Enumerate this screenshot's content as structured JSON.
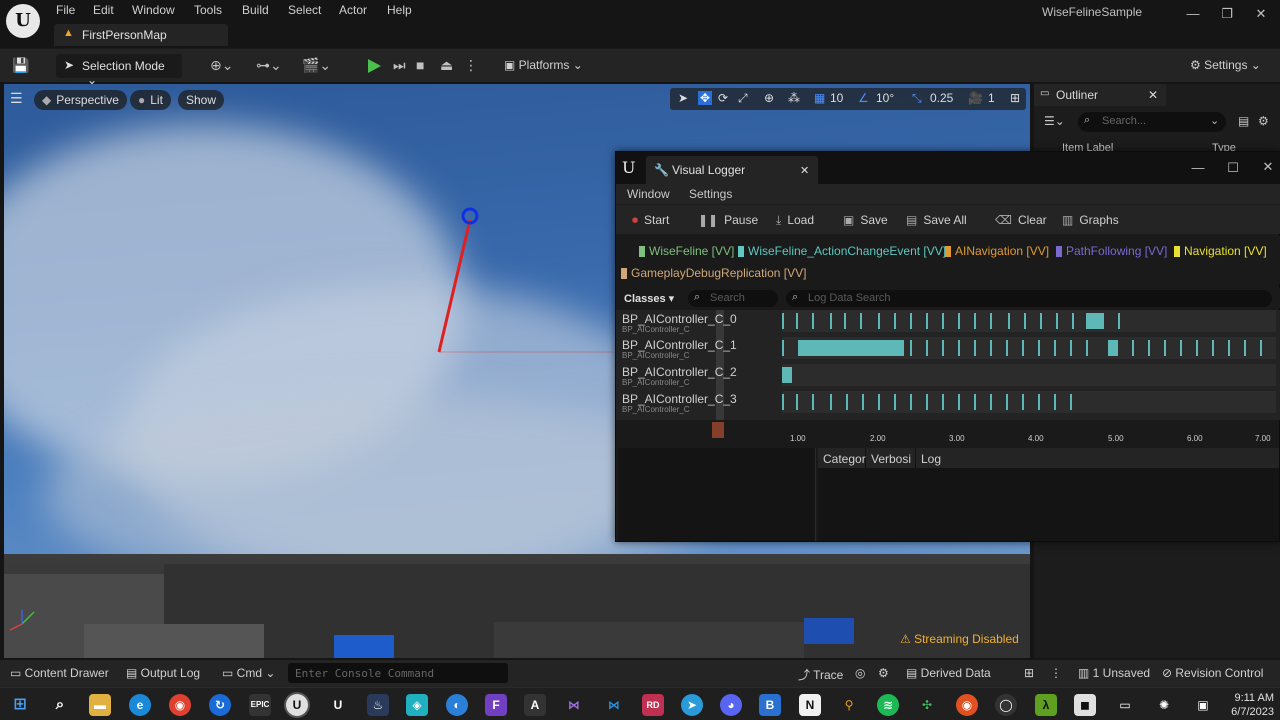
{
  "app": {
    "logo_text": "U",
    "menu": [
      "File",
      "Edit",
      "Window",
      "Tools",
      "Build",
      "Select",
      "Actor",
      "Help"
    ],
    "map_tab": "FirstPersonMap",
    "project_name": "WiseFelineSample"
  },
  "toolbar": {
    "selection_mode": "Selection Mode",
    "platforms": "Platforms",
    "settings": "Settings"
  },
  "viewport": {
    "perspective": "Perspective",
    "lit": "Lit",
    "show": "Show",
    "grid_snap": "10",
    "rotation_snap": "10°",
    "scale_snap": "0.25",
    "camera_speed": "1",
    "streaming_status": "Streaming Disabled"
  },
  "outliner": {
    "title": "Outliner",
    "search_placeholder": "Search...",
    "col_label": "Item Label",
    "col_type": "Type"
  },
  "visual_logger": {
    "title": "Visual Logger",
    "menu": [
      "Window",
      "Settings"
    ],
    "actions": [
      "Start",
      "Pause",
      "Load",
      "Save",
      "Save All",
      "Clear",
      "Graphs"
    ],
    "categories": [
      {
        "label": "WiseFeline [VV]",
        "color": "#7fbf7f"
      },
      {
        "label": "WiseFeline_ActionChangeEvent [VV]",
        "color": "#5fc8c0"
      },
      {
        "label": "AINavigation [VV]",
        "color": "#e09a30"
      },
      {
        "label": "PathFollowing [VV]",
        "color": "#7a6ad0"
      },
      {
        "label": "Navigation [VV]",
        "color": "#e8e030"
      },
      {
        "label": "GameplayDebugReplication [VV]",
        "color": "#d0a878"
      }
    ],
    "classes_label": "Classes",
    "class_search_placeholder": "Search",
    "log_search_placeholder": "Log Data Search",
    "rows": [
      {
        "name": "BP_AIController_C_0",
        "class": "BP_AIController_C"
      },
      {
        "name": "BP_AIController_C_1",
        "class": "BP_AIController_C"
      },
      {
        "name": "BP_AIController_C_2",
        "class": "BP_AIController_C"
      },
      {
        "name": "BP_AIController_C_3",
        "class": "BP_AIController_C"
      }
    ],
    "axis_labels": [
      "1.00",
      "2.00",
      "3.00",
      "4.00",
      "5.00",
      "6.00",
      "7.00"
    ],
    "log_columns": [
      "Categor",
      "Verbosi",
      "Log"
    ]
  },
  "statusbar": {
    "content_drawer": "Content Drawer",
    "output_log": "Output Log",
    "cmd": "Cmd",
    "console_placeholder": "Enter Console Command",
    "trace": "Trace",
    "derived_data": "Derived Data",
    "unsaved": "1 Unsaved",
    "revision_control": "Revision Control"
  },
  "taskbar": {
    "time": "9:11 AM",
    "date": "6/7/2023"
  }
}
